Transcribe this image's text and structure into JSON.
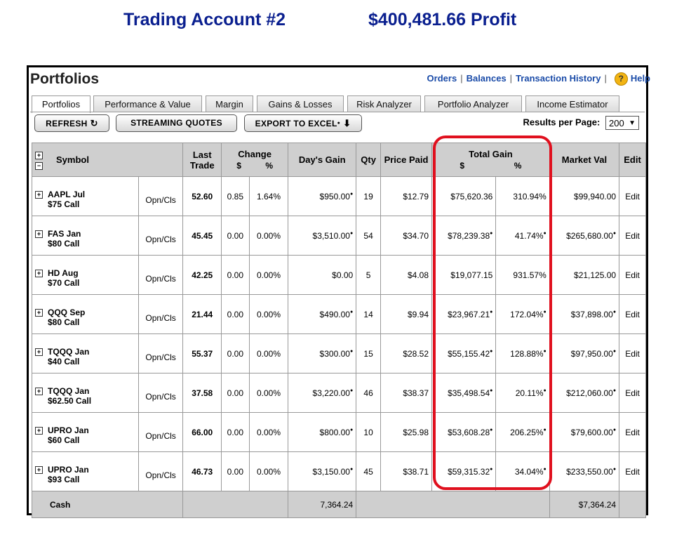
{
  "headline": {
    "account": "Trading Account #2",
    "profit": "$400,481.66 Profit"
  },
  "portfolios": {
    "title": "Portfolios",
    "links": [
      "Orders",
      "Balances",
      "Transaction History"
    ],
    "help_label": "Help",
    "help_icon": "question-icon"
  },
  "tabs": [
    "Portfolios",
    "Performance & Value",
    "Margin",
    "Gains & Losses",
    "Risk Analyzer",
    "Portfolio Analyzer",
    "Income Estimator"
  ],
  "active_tab": "Portfolios",
  "toolbar": {
    "refresh": "REFRESH",
    "streaming": "STREAMING QUOTES",
    "export": "EXPORT TO EXCEL",
    "results_label": "Results per Page:",
    "results_value": "200"
  },
  "columns": {
    "symbol": "Symbol",
    "last_trade": "Last Trade",
    "change": "Change",
    "change_dollar": "$",
    "change_pct": "%",
    "days_gain": "Day's Gain",
    "qty": "Qty",
    "price_paid": "Price Paid",
    "total_gain": "Total Gain",
    "tg_dollar": "$",
    "tg_pct": "%",
    "market_val": "Market Val",
    "edit": "Edit"
  },
  "rows": [
    {
      "sym1": "AAPL Jul",
      "sym2": "$75 Call",
      "oc": "Opn/Cls",
      "last": "52.60",
      "chg": "0.85",
      "chgp": "1.64%",
      "dg": "$950.00",
      "qty": "19",
      "paid": "$12.79",
      "tg": "$75,620.36",
      "tgp": "310.94%",
      "mv": "$99,940.00",
      "edit": "Edit"
    },
    {
      "sym1": "FAS Jan",
      "sym2": "$80 Call",
      "oc": "Opn/Cls",
      "last": "45.45",
      "chg": "0.00",
      "chgp": "0.00%",
      "dg": "$3,510.00",
      "qty": "54",
      "paid": "$34.70",
      "tg": "$78,239.38",
      "tgp": "41.74%",
      "mv": "$265,680.00",
      "edit": "Edit"
    },
    {
      "sym1": "HD Aug",
      "sym2": "$70 Call",
      "oc": "Opn/Cls",
      "last": "42.25",
      "chg": "0.00",
      "chgp": "0.00%",
      "dg": "$0.00",
      "qty": "5",
      "paid": "$4.08",
      "tg": "$19,077.15",
      "tgp": "931.57%",
      "mv": "$21,125.00",
      "edit": "Edit"
    },
    {
      "sym1": "QQQ Sep",
      "sym2": "$80 Call",
      "oc": "Opn/Cls",
      "last": "21.44",
      "chg": "0.00",
      "chgp": "0.00%",
      "dg": "$490.00",
      "qty": "14",
      "paid": "$9.94",
      "tg": "$23,967.21",
      "tgp": "172.04%",
      "mv": "$37,898.00",
      "edit": "Edit"
    },
    {
      "sym1": "TQQQ Jan",
      "sym2": "$40 Call",
      "oc": "Opn/Cls",
      "last": "55.37",
      "chg": "0.00",
      "chgp": "0.00%",
      "dg": "$300.00",
      "qty": "15",
      "paid": "$28.52",
      "tg": "$55,155.42",
      "tgp": "128.88%",
      "mv": "$97,950.00",
      "edit": "Edit"
    },
    {
      "sym1": "TQQQ Jan",
      "sym2": "$62.50 Call",
      "oc": "Opn/Cls",
      "last": "37.58",
      "chg": "0.00",
      "chgp": "0.00%",
      "dg": "$3,220.00",
      "qty": "46",
      "paid": "$38.37",
      "tg": "$35,498.54",
      "tgp": "20.11%",
      "mv": "$212,060.00",
      "edit": "Edit"
    },
    {
      "sym1": "UPRO Jan",
      "sym2": "$60 Call",
      "oc": "Opn/Cls",
      "last": "66.00",
      "chg": "0.00",
      "chgp": "0.00%",
      "dg": "$800.00",
      "qty": "10",
      "paid": "$25.98",
      "tg": "$53,608.28",
      "tgp": "206.25%",
      "mv": "$79,600.00",
      "edit": "Edit"
    },
    {
      "sym1": "UPRO Jan",
      "sym2": "$93 Call",
      "oc": "Opn/Cls",
      "last": "46.73",
      "chg": "0.00",
      "chgp": "0.00%",
      "dg": "$3,150.00",
      "qty": "45",
      "paid": "$38.71",
      "tg": "$59,315.32",
      "tgp": "34.04%",
      "mv": "$233,550.00",
      "edit": "Edit"
    }
  ],
  "cash": {
    "label": "Cash",
    "days_gain": "7,364.24",
    "market_val": "$7,364.24"
  },
  "colors": {
    "headline": "#0a1f8f",
    "link": "#1a4ba8",
    "header_bg": "#cfcfcf",
    "highlight": "#e0101e"
  }
}
